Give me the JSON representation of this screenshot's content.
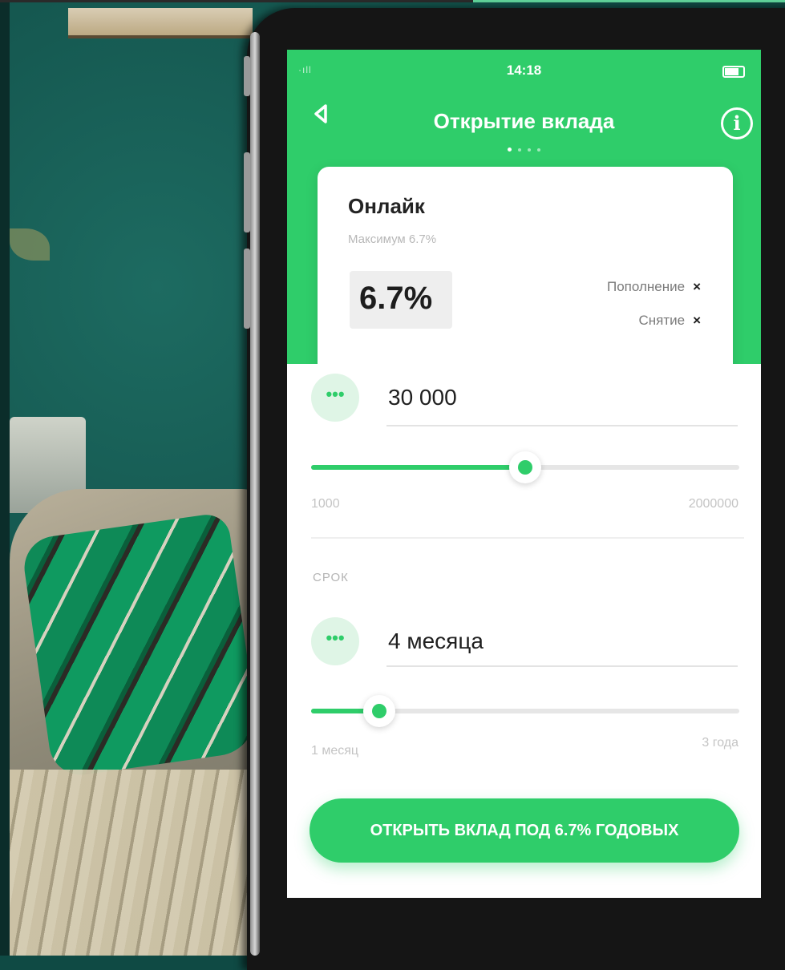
{
  "status": {
    "time": "14:18",
    "signal": "·ıll"
  },
  "header": {
    "title": "Открытие вклада",
    "back_icon": "chevron-left-icon",
    "info_icon": "info-icon",
    "info_glyph": "i"
  },
  "pager": {
    "count": 4,
    "active": 1
  },
  "deposit": {
    "name": "Онлайк",
    "subtitle": "Максимум 6.7%",
    "rate": "6.7%",
    "features": [
      {
        "label": "Пополнение",
        "mark": "×"
      },
      {
        "label": "Снятие",
        "mark": "×"
      }
    ]
  },
  "amount": {
    "menu_glyph": "•••",
    "value": "30 000",
    "min_label": "1000",
    "max_label": "2000000",
    "slider_fraction": 0.5
  },
  "term": {
    "section_label": "СРОК",
    "menu_glyph": "•••",
    "value": "4 месяца",
    "min_label": "1 месяц",
    "max_label": "3 года",
    "slider_fraction": 0.16
  },
  "cta": {
    "label": "ОТКРЫТЬ ВКЛАД ПОД 6.7% ГОДОВЫХ"
  },
  "colors": {
    "accent": "#2fcd6a",
    "accent_light": "#dff5e6"
  }
}
